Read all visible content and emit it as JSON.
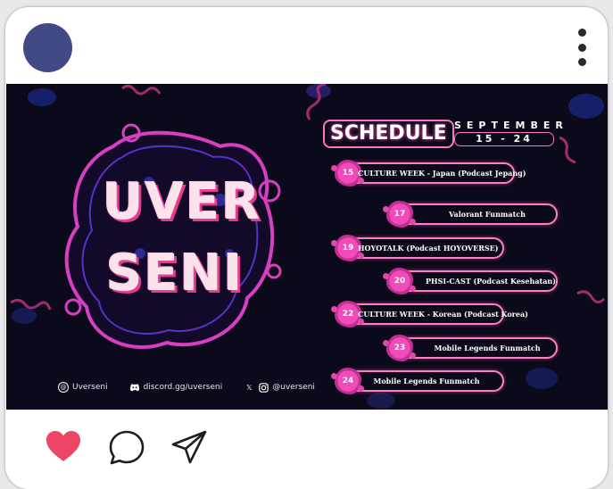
{
  "post": {
    "logo_line1": "UVER",
    "logo_line2": "SENI",
    "schedule_title": "SCHEDULE",
    "month": "SEPTEMBER",
    "date_range": "15 - 24",
    "events": [
      {
        "day": "15",
        "label": "CULTURE WEEK - Japan (Podcast Jepang)"
      },
      {
        "day": "17",
        "label": "Valorant Funmatch"
      },
      {
        "day": "19",
        "label": "HOYOTALK (Podcast HOYOVERSE)"
      },
      {
        "day": "20",
        "label": "PHSI-CAST (Podcast Kesehatan)"
      },
      {
        "day": "22",
        "label": "CULTURE WEEK - Korean (Podcast Korea)"
      },
      {
        "day": "23",
        "label": "Mobile Legends Funmatch"
      },
      {
        "day": "24",
        "label": "Mobile Legends Funmatch"
      }
    ],
    "socials": {
      "threads": "Uverseni",
      "discord": "discord.gg/uverseni",
      "x_instagram": "@uverseni"
    }
  },
  "icons": {
    "more": "more-vertical-icon",
    "like": "heart-icon",
    "comment": "comment-icon",
    "share": "send-icon"
  },
  "colors": {
    "avatar": "#414a85",
    "accent_pink": "#ff5aa8",
    "heart": "#ee4567",
    "post_bg": "#0b0a1b"
  }
}
